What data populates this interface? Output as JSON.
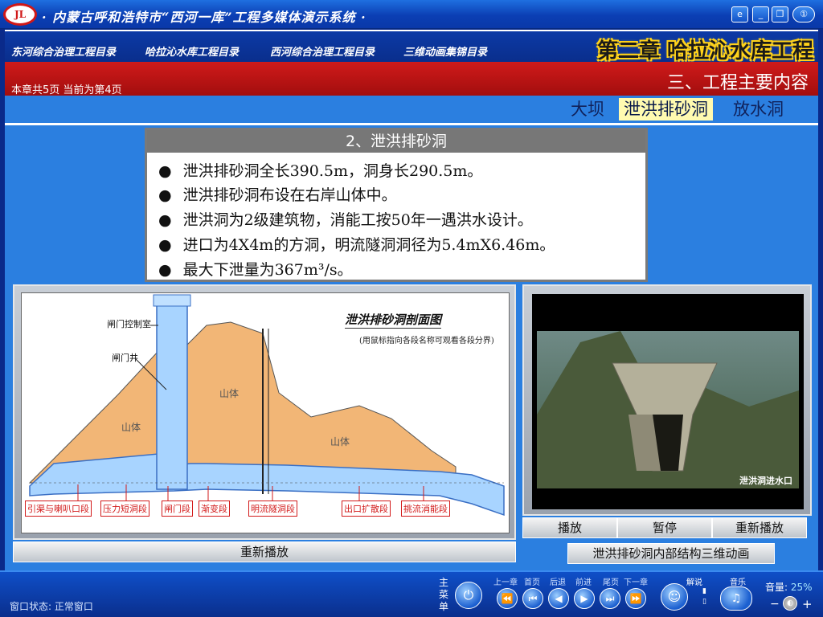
{
  "window": {
    "title": "· 内蒙古呼和浩特市“西河一库”工程多媒体演示系统 ·",
    "logo_text": "JL"
  },
  "menu": {
    "items": [
      "东河综合治理工程目录",
      "哈拉沁水库工程目录",
      "西河综合治理工程目录",
      "三维动画集锦目录"
    ],
    "chapter": "第二章 哈拉沁水库工程"
  },
  "page": {
    "info": "本章共5页   当前为第4页",
    "section_title": "三、工程主要内容"
  },
  "subtabs": [
    {
      "label": "大坝",
      "active": false
    },
    {
      "label": "泄洪排砂洞",
      "active": true
    },
    {
      "label": "放水洞",
      "active": false
    }
  ],
  "textbox": {
    "title": "2、泄洪排砂洞",
    "bullets": [
      "泄洪排砂洞全长390.5m，洞身长290.5m。",
      "泄洪排砂洞布设在右岸山体中。",
      "泄洪洞为2级建筑物，消能工按50年一遇洪水设计。",
      "进口为4X4m的方洞，明流隧洞洞径为5.4mX6.46m。",
      "最大下泄量为367m³/s。"
    ]
  },
  "diagram": {
    "title": "泄洪排砂洞剖面图",
    "subtitle": "(用鼠标指向各段名称可观看各段分界)",
    "callouts": [
      "闸门控制室",
      "闸门井"
    ],
    "mountain_labels": [
      "山体",
      "山体",
      "山体"
    ],
    "segments": [
      "引渠与喇叭口段",
      "压力短洞段",
      "闸门段",
      "渐变段",
      "明流隧洞段",
      "出口扩散段",
      "挑流消能段"
    ],
    "replay_label": "重新播放"
  },
  "video": {
    "caption": "泄洪洞进水口",
    "buttons": [
      "播放",
      "暂停",
      "重新播放"
    ],
    "animation_button": "泄洪排砂洞内部结构三维动画"
  },
  "bottom": {
    "status": "窗口状态:  正常窗口",
    "main_menu": "主菜单",
    "nav_labels": [
      "上一章",
      "首页",
      "后退",
      "前进",
      "尾页",
      "下一章"
    ],
    "explain_label": "解说",
    "music_label": "音乐",
    "volume_label": "音量:",
    "volume_value": "25%"
  },
  "colors": {
    "title_blue": "#0b3fb4",
    "red_band": "#c01414",
    "content_blue": "#2b7fe0",
    "chapter_yellow": "#ffd21a",
    "mountain": "#f2b676",
    "water": "#a8d4ff",
    "segment_label_red": "#d21a1a"
  }
}
